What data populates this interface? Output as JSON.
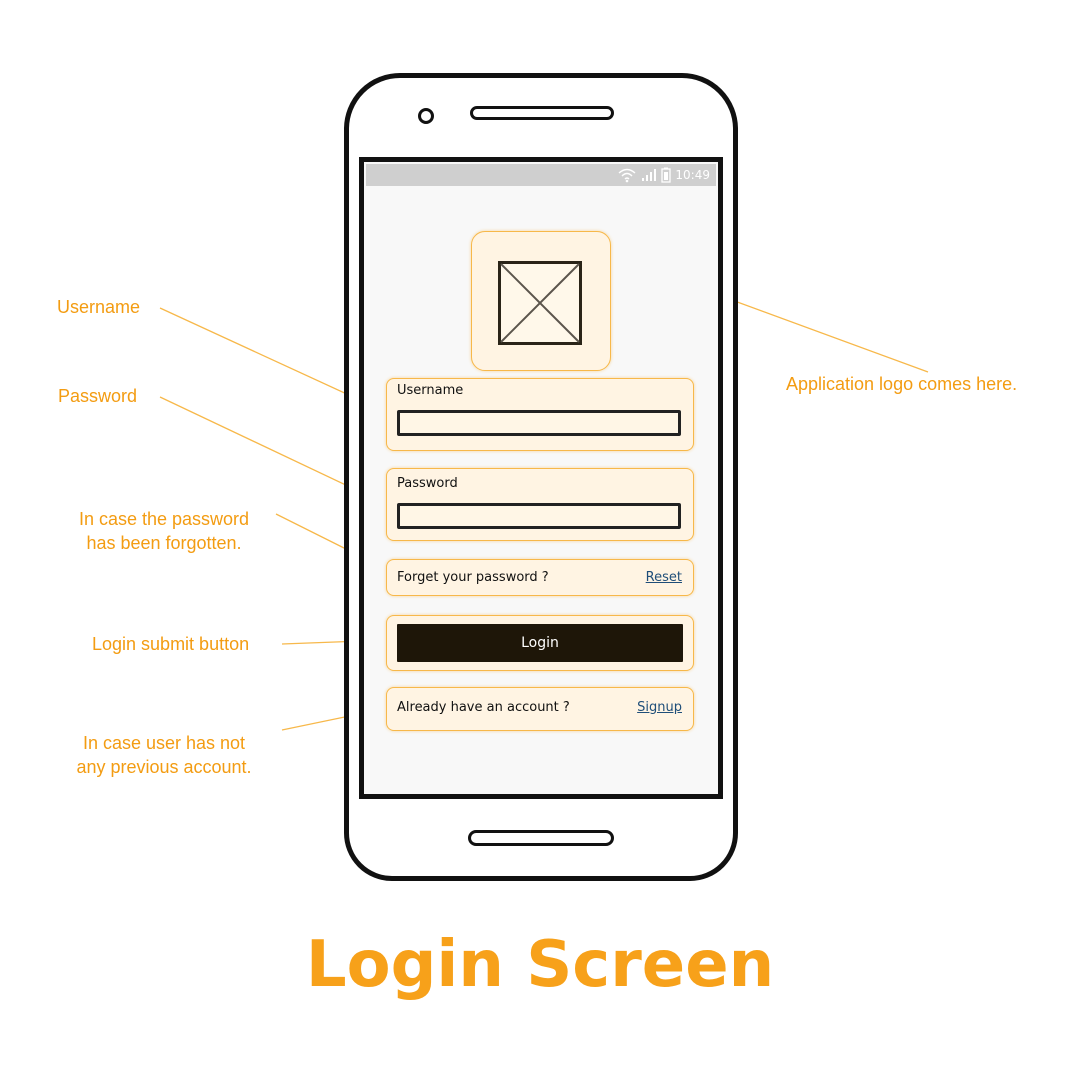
{
  "title": "Login Screen",
  "status_bar": {
    "time": "10:49"
  },
  "screen": {
    "username_label": "Username",
    "password_label": "Password",
    "forgot_text": "Forget your password ?",
    "reset_link": "Reset",
    "login_button": "Login",
    "account_text": "Already have an account ?",
    "signup_link": "Signup"
  },
  "annotations": {
    "username": "Username",
    "password": "Password",
    "forgot_line1": "In case the password",
    "forgot_line2": "has been forgotten.",
    "login": "Login submit button",
    "account_line1": "In case user has not",
    "account_line2": "any previous account.",
    "logo": "Application logo comes here."
  },
  "colors": {
    "accent": "#f39c12",
    "highlight_fill": "#fff4e3",
    "highlight_border": "#f7b84a",
    "button": "#1e1608",
    "link": "#1f4e79"
  }
}
